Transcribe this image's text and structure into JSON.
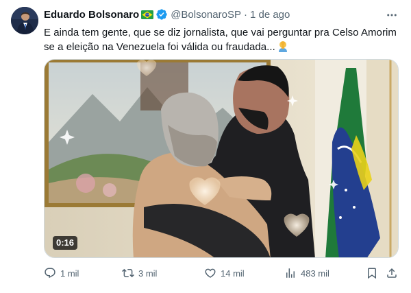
{
  "author": {
    "name": "Eduardo Bolsonaro",
    "handle": "@BolsonaroSP",
    "separator": "·",
    "time": "1 de ago"
  },
  "tweet": {
    "text": "E ainda tem gente, que se diz jornalista, que vai perguntar pra Celso Amorim se a eleição na Venezuela foi válida ou fraudada..."
  },
  "media": {
    "duration": "0:16"
  },
  "actions": {
    "replies": "1 mil",
    "retweets": "3 mil",
    "likes": "14 mil",
    "views": "483 mil"
  },
  "icons": {
    "flag": "brazil-flag-icon",
    "verified": "verified-badge-icon",
    "more": "more-icon",
    "reply": "reply-icon",
    "retweet": "retweet-icon",
    "like": "heart-icon",
    "views": "views-icon",
    "bookmark": "bookmark-icon",
    "share": "share-icon"
  },
  "colors": {
    "text": "#0f1419",
    "secondary": "#536471",
    "verified": "#1d9bf0"
  }
}
